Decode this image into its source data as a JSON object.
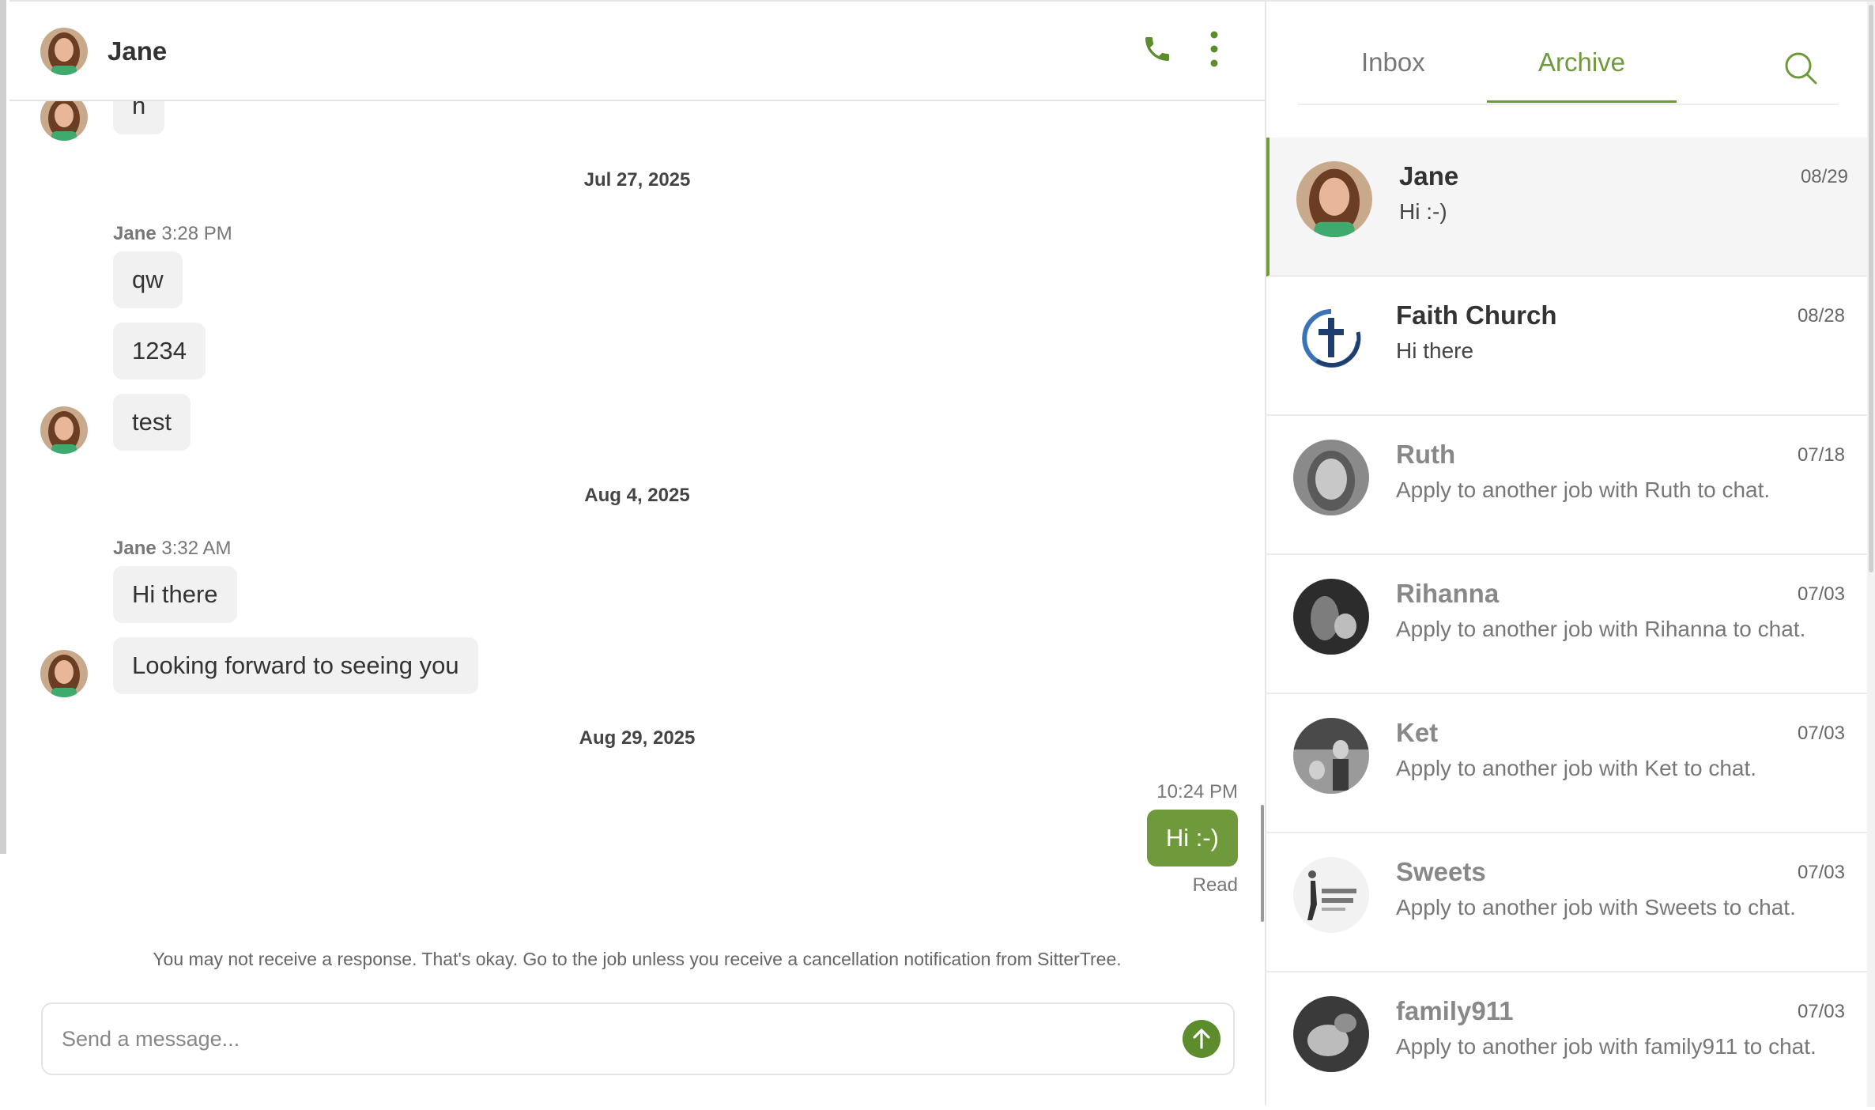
{
  "chat": {
    "contact_name": "Jane",
    "messages_top_partial": "h",
    "groups": [
      {
        "date": "Jul 27, 2025",
        "sender": "Jane",
        "time": "3:28 PM",
        "messages": [
          "qw",
          "1234",
          "test"
        ]
      },
      {
        "date": "Aug 4, 2025",
        "sender": "Jane",
        "time": "3:32 AM",
        "messages": [
          "Hi there",
          "Looking forward to seeing you"
        ]
      },
      {
        "date": "Aug 29, 2025",
        "outgoing_time": "10:24 PM",
        "outgoing_message": "Hi :-)",
        "status": "Read"
      }
    ],
    "notice": "You may not receive a response. That's okay. Go to the job unless you receive a cancellation notification from SitterTree.",
    "composer": {
      "placeholder": "Send a message..."
    }
  },
  "sidebar": {
    "tabs": [
      {
        "label": "Inbox",
        "active": false
      },
      {
        "label": "Archive",
        "active": true
      }
    ],
    "conversations": [
      {
        "name": "Jane",
        "date": "08/29",
        "preview": "Hi :-)",
        "active": true
      },
      {
        "name": "Faith Church",
        "date": "08/28",
        "preview": "Hi there",
        "active": false
      },
      {
        "name": "Ruth",
        "date": "07/18",
        "preview": "Apply to another job with Ruth to chat.",
        "active": false
      },
      {
        "name": "Rihanna",
        "date": "07/03",
        "preview": "Apply to another job with Rihanna to chat.",
        "active": false
      },
      {
        "name": "Ket",
        "date": "07/03",
        "preview": "Apply to another job with Ket to chat.",
        "active": false
      },
      {
        "name": "Sweets",
        "date": "07/03",
        "preview": "Apply to another job with Sweets to chat.",
        "active": false
      },
      {
        "name": "family911",
        "date": "07/03",
        "preview": "Apply to another job with family911 to chat.",
        "active": false
      }
    ]
  },
  "colors": {
    "accent": "#6f9a3b",
    "bubble_in": "#f1f1f1",
    "active_row": "#f5f5f5"
  },
  "icons": {
    "call": "phone-icon",
    "more": "more-vertical-icon",
    "search": "search-icon",
    "send": "arrow-up-icon",
    "church": "cross-logo-icon"
  }
}
